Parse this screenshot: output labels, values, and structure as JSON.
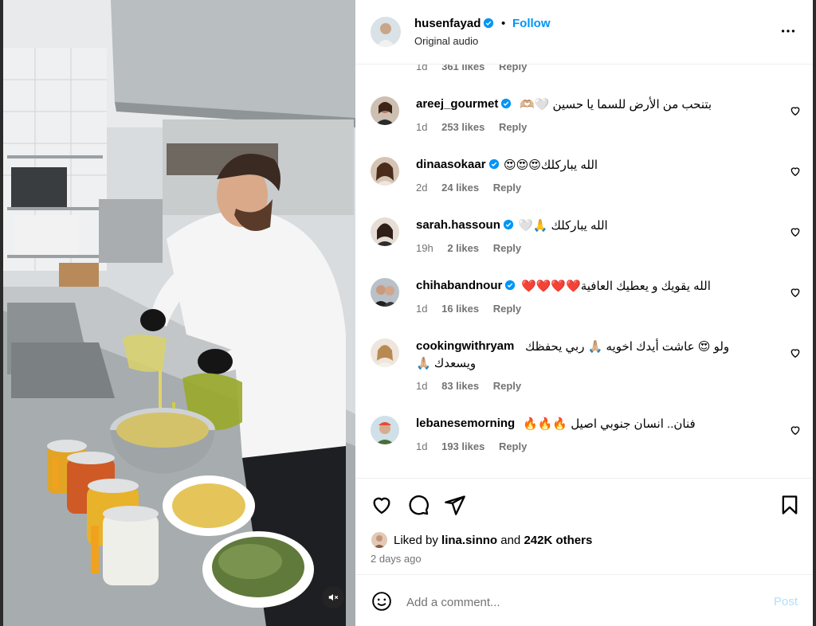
{
  "header": {
    "username": "husenfayad",
    "separator": "•",
    "follow_label": "Follow",
    "subtitle": "Original audio",
    "more_icon": "more-horizontal-icon"
  },
  "prev_comment_meta": {
    "time": "1d",
    "likes": "361 likes",
    "reply": "Reply"
  },
  "comments": [
    {
      "user": "areej_gourmet",
      "verified": true,
      "text": "بتنحب من الأرض للسما يا حسين 🤍🫶🏼",
      "time": "1d",
      "likes": "253 likes",
      "reply": "Reply"
    },
    {
      "user": "dinaasokaar",
      "verified": true,
      "text": "الله يباركلك😍😍😍",
      "time": "2d",
      "likes": "24 likes",
      "reply": "Reply"
    },
    {
      "user": "sarah.hassoun",
      "verified": true,
      "text": "الله يباركلك 🙏🤍",
      "time": "19h",
      "likes": "2 likes",
      "reply": "Reply"
    },
    {
      "user": "chihabandnour",
      "verified": true,
      "text": "الله يقويك و يعطيك العافية❤️❤️❤️❤️",
      "time": "1d",
      "likes": "16 likes",
      "reply": "Reply"
    },
    {
      "user": "cookingwithryam",
      "verified": false,
      "text_line1": "ولو 😍 عاشت أيدك اخويه 🙏🏼 ربي يحفظك",
      "text_line2": "ويسعدك 🙏🏼",
      "time": "1d",
      "likes": "83 likes",
      "reply": "Reply"
    },
    {
      "user": "lebanesemorning",
      "verified": false,
      "text": "فنان.. انسان جنوبي اصيل 🔥🔥🔥",
      "time": "1d",
      "likes": "193 likes",
      "reply": "Reply"
    }
  ],
  "actions": {
    "like_icon": "heart-icon",
    "comment_icon": "comment-icon",
    "share_icon": "share-icon",
    "save_icon": "bookmark-icon"
  },
  "liked_by": {
    "prefix": "Liked by",
    "user": "lina.sinno",
    "and": "and",
    "others": "242K others"
  },
  "posted_ago": "2 days ago",
  "add_comment": {
    "placeholder": "Add a comment...",
    "post_label": "Post"
  },
  "colors": {
    "accent": "#0095f6",
    "muted": "#737373",
    "post_disabled": "#b2dffc",
    "like_red": "#ff3040"
  }
}
